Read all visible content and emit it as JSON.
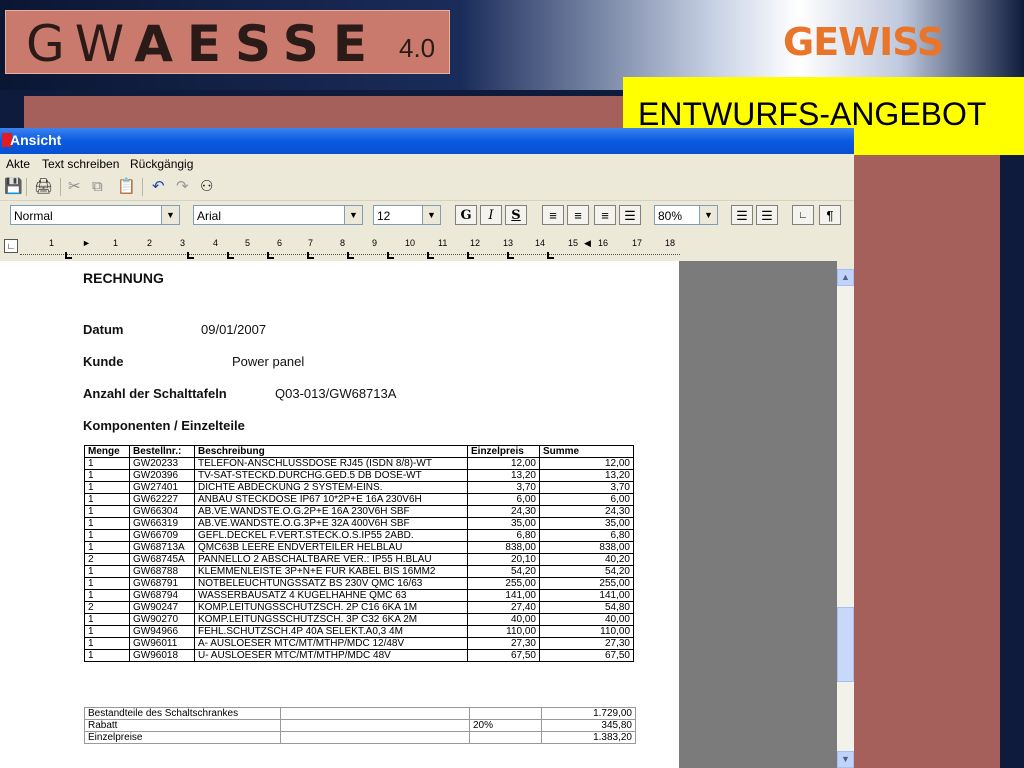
{
  "app": {
    "logo_light": "GW",
    "logo_bold": "AESSE",
    "version": "4.0",
    "brand": "GEWISS",
    "banner": "ENTWURFS-ANGEBOT"
  },
  "window": {
    "title": "Ansicht",
    "menu": [
      "Akte",
      "Text schreiben",
      "Rückgängig"
    ]
  },
  "format": {
    "style": "Normal",
    "font": "Arial",
    "size": "12",
    "bold": "G",
    "italic": "I",
    "underline": "S",
    "zoom": "80%"
  },
  "ruler": [
    "1",
    "1",
    "2",
    "3",
    "4",
    "5",
    "6",
    "7",
    "8",
    "9",
    "10",
    "11",
    "12",
    "13",
    "14",
    "15",
    "16",
    "17",
    "18"
  ],
  "doc": {
    "title": "RECHNUNG",
    "date_label": "Datum",
    "date_value": "09/01/2007",
    "customer_label": "Kunde",
    "customer_value": "Power panel",
    "panels_label": "Anzahl der Schalttafeln",
    "panels_value": "Q03-013/GW68713A",
    "components_label": "Komponenten / Einzelteile",
    "columns": [
      "Menge",
      "Bestellnr.:",
      "Beschreibung",
      "Einzelpreis",
      "Summe"
    ],
    "rows": [
      [
        "1",
        "GW20233",
        "TELEFON-ANSCHLUSSDOSE RJ45 (ISDN 8/8)-WT",
        "12,00",
        "12,00"
      ],
      [
        "1",
        "GW20396",
        "TV-SAT-STECKD.DURCHG.GED.5 DB DOSE-WT",
        "13,20",
        "13,20"
      ],
      [
        "1",
        "GW27401",
        "DICHTE ABDECKUNG 2 SYSTEM-EINS.",
        "3,70",
        "3,70"
      ],
      [
        "1",
        "GW62227",
        "ANBAU STECKDOSE IP67 10*2P+E 16A 230V6H",
        "6,00",
        "6,00"
      ],
      [
        "1",
        "GW66304",
        "AB.VE.WANDSTE.O.G.2P+E 16A 230V6H SBF",
        "24,30",
        "24,30"
      ],
      [
        "1",
        "GW66319",
        "AB.VE.WANDSTE.O.G.3P+E 32A 400V6H SBF",
        "35,00",
        "35,00"
      ],
      [
        "1",
        "GW66709",
        "GEFL.DECKEL F.VERT.STECK.O.S.IP55 2ABD.",
        "6,80",
        "6,80"
      ],
      [
        "1",
        "GW68713A",
        "QMC63B LEERE ENDVERTEILER HELBLAU",
        "838,00",
        "838,00"
      ],
      [
        "2",
        "GW68745A",
        "PANNELLO 2 ABSCHALTBARE VER.: IP55 H.BLAU",
        "20,10",
        "40,20"
      ],
      [
        "1",
        "GW68788",
        "KLEMMENLEISTE 3P+N+E FUR KABEL BIS 16MM2",
        "54,20",
        "54,20"
      ],
      [
        "1",
        "GW68791",
        "NOTBELEUCHTUNGSSATZ BS 230V QMC 16/63",
        "255,00",
        "255,00"
      ],
      [
        "1",
        "GW68794",
        "WASSERBAUSATZ 4 KUGELHAHNE QMC 63",
        "141,00",
        "141,00"
      ],
      [
        "2",
        "GW90247",
        "KOMP.LEITUNGSSCHUTZSCH. 2P C16 6KA 1M",
        "27,40",
        "54,80"
      ],
      [
        "1",
        "GW90270",
        "KOMP.LEITUNGSSCHUTZSCH. 3P C32 6KA 2M",
        "40,00",
        "40,00"
      ],
      [
        "1",
        "GW94966",
        "FEHL.SCHUTZSCH.4P 40A SELEKT.A0,3 4M",
        "110,00",
        "110,00"
      ],
      [
        "1",
        "GW96011",
        "A- AUSLOESER MTC/MT/MTHP/MDC 12/48V",
        "27,30",
        "27,30"
      ],
      [
        "1",
        "GW96018",
        "U- AUSLOESER  MTC/MT/MTHP/MDC 48V",
        "67,50",
        "67,50"
      ]
    ],
    "totals": [
      [
        "Bestandteile des Schaltschrankes",
        "",
        "",
        "1.729,00"
      ],
      [
        "Rabatt",
        "",
        "20%",
        "345,80"
      ],
      [
        "Einzelpreise",
        "",
        "",
        "1.383,20"
      ]
    ]
  }
}
